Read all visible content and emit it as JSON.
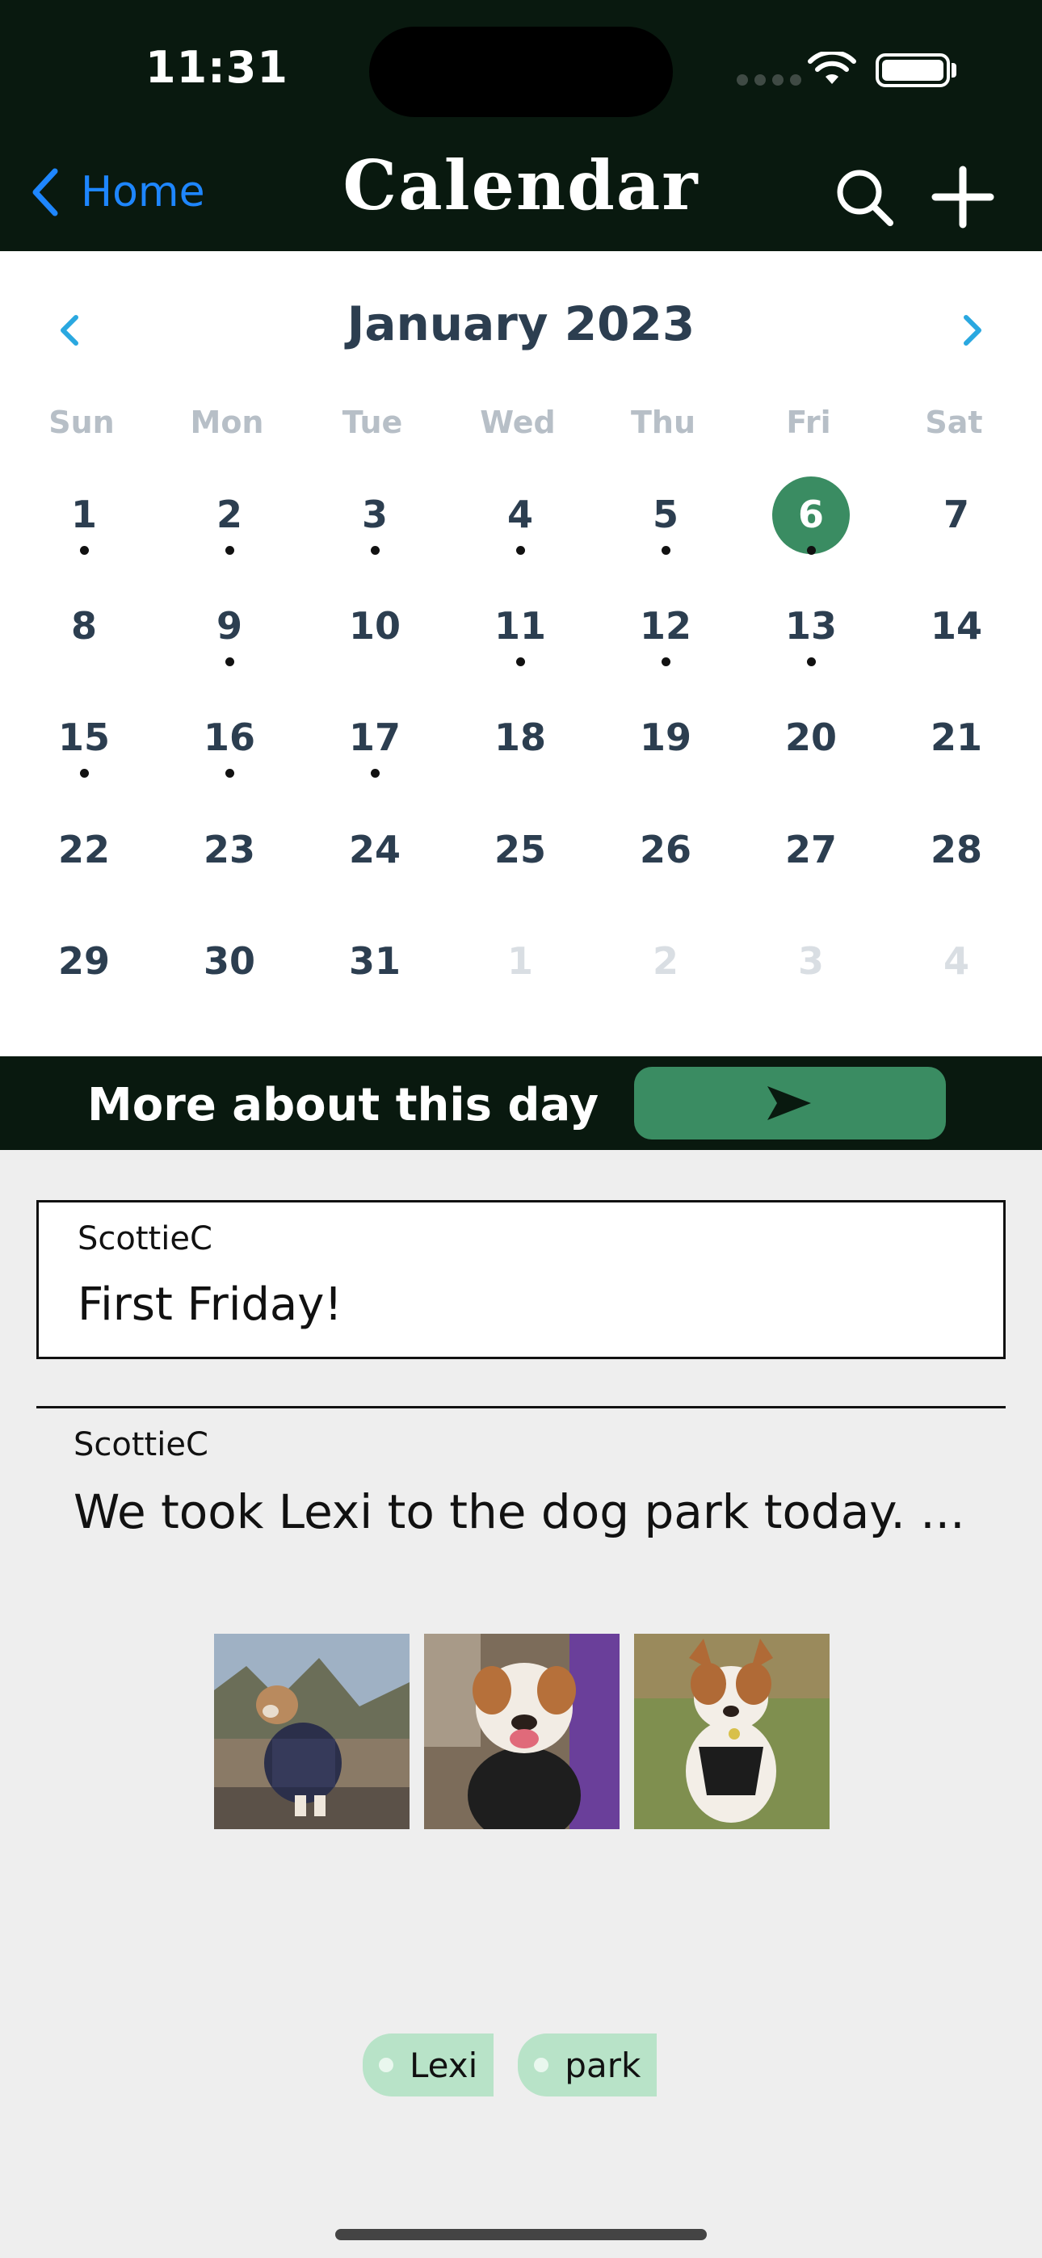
{
  "status_bar": {
    "time": "11:31"
  },
  "nav": {
    "back_label": "Home",
    "title": "Calendar"
  },
  "calendar": {
    "month_label": "January 2023",
    "weekdays": [
      "Sun",
      "Mon",
      "Tue",
      "Wed",
      "Thu",
      "Fri",
      "Sat"
    ],
    "weeks": [
      [
        {
          "n": "1",
          "dot": true
        },
        {
          "n": "2",
          "dot": true
        },
        {
          "n": "3",
          "dot": true
        },
        {
          "n": "4",
          "dot": true
        },
        {
          "n": "5",
          "dot": true
        },
        {
          "n": "6",
          "dot": true,
          "selected": true
        },
        {
          "n": "7"
        }
      ],
      [
        {
          "n": "8"
        },
        {
          "n": "9",
          "dot": true
        },
        {
          "n": "10"
        },
        {
          "n": "11",
          "dot": true
        },
        {
          "n": "12",
          "dot": true
        },
        {
          "n": "13",
          "dot": true
        },
        {
          "n": "14"
        }
      ],
      [
        {
          "n": "15",
          "dot": true
        },
        {
          "n": "16",
          "dot": true
        },
        {
          "n": "17",
          "dot": true
        },
        {
          "n": "18"
        },
        {
          "n": "19"
        },
        {
          "n": "20"
        },
        {
          "n": "21"
        }
      ],
      [
        {
          "n": "22"
        },
        {
          "n": "23"
        },
        {
          "n": "24"
        },
        {
          "n": "25"
        },
        {
          "n": "26"
        },
        {
          "n": "27"
        },
        {
          "n": "28"
        }
      ],
      [
        {
          "n": "29"
        },
        {
          "n": "30"
        },
        {
          "n": "31"
        },
        {
          "n": "1",
          "other": true
        },
        {
          "n": "2",
          "other": true
        },
        {
          "n": "3",
          "other": true
        },
        {
          "n": "4",
          "other": true
        }
      ]
    ]
  },
  "more_bar": {
    "label": "More about this day"
  },
  "entry": {
    "author": "ScottieC",
    "title": "First Friday!"
  },
  "post": {
    "author": "ScottieC",
    "text": "We took Lexi to the dog park today. ...",
    "photos": [
      "dog-photo-1",
      "dog-photo-2",
      "dog-photo-3"
    ]
  },
  "tags": [
    "Lexi",
    "park"
  ],
  "colors": {
    "header_bg": "#09190f",
    "accent_green": "#3a8c62",
    "tag_bg": "#b8e3c8",
    "link_blue": "#1e86ff"
  }
}
